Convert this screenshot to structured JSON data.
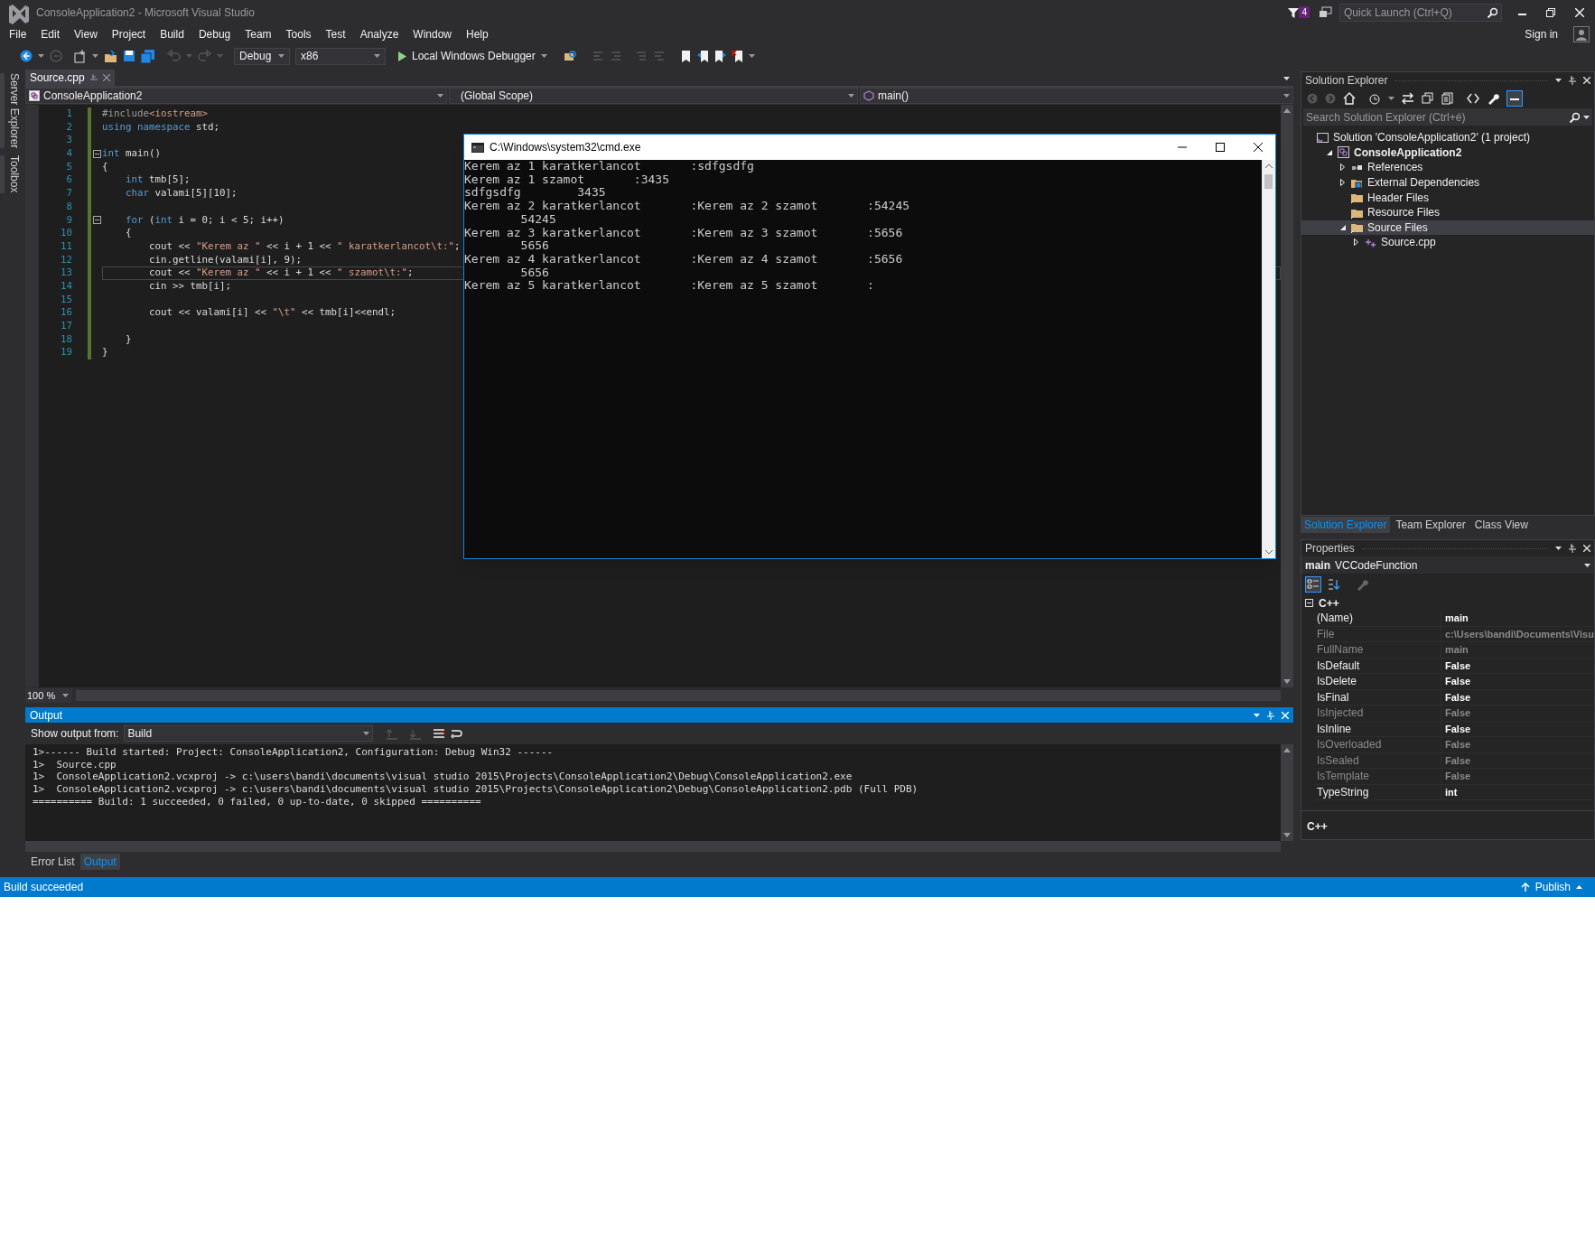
{
  "window": {
    "title": "ConsoleApplication2 - Microsoft Visual Studio"
  },
  "title_bar": {
    "notification_count": "4",
    "quick_launch": {
      "placeholder": "Quick Launch (Ctrl+Q)"
    },
    "sign_in": "Sign in"
  },
  "menu": [
    "File",
    "Edit",
    "View",
    "Project",
    "Build",
    "Debug",
    "Team",
    "Tools",
    "Test",
    "Analyze",
    "Window",
    "Help"
  ],
  "toolbar": {
    "configuration": "Debug",
    "platform": "x86",
    "start": "Local Windows Debugger"
  },
  "side_tabs": [
    "Server Explorer",
    "Toolbox"
  ],
  "editor": {
    "tabs": [
      {
        "label": "Source.cpp",
        "selected": true
      }
    ],
    "nav": {
      "project": "ConsoleApplication2",
      "scope": "(Global Scope)",
      "member": "main()"
    },
    "lines": [
      {
        "number": "1",
        "fold": false,
        "current": false,
        "tokens": [
          {
            "kind": "preprocessor",
            "text": "#include"
          },
          {
            "kind": "string",
            "text": "<iostream>"
          }
        ]
      },
      {
        "number": "2",
        "fold": false,
        "current": false,
        "tokens": [
          {
            "kind": "keyword",
            "text": "using namespace"
          },
          {
            "kind": "plain",
            "text": " std;"
          }
        ]
      },
      {
        "number": "3",
        "fold": false,
        "current": false
      },
      {
        "number": "4",
        "fold": true,
        "current": false,
        "tokens": [
          {
            "kind": "keyword",
            "text": "int"
          },
          {
            "kind": "plain",
            "text": " main()"
          }
        ]
      },
      {
        "number": "5",
        "fold": false,
        "current": false,
        "tokens": [
          {
            "kind": "plain",
            "text": "{"
          }
        ]
      },
      {
        "number": "6",
        "fold": false,
        "current": false,
        "tokens": [
          {
            "kind": "keyword",
            "text": "    int"
          },
          {
            "kind": "plain",
            "text": " tmb[5];"
          }
        ]
      },
      {
        "number": "7",
        "fold": false,
        "current": false,
        "tokens": [
          {
            "kind": "keyword",
            "text": "    char"
          },
          {
            "kind": "plain",
            "text": " valami[5][10];"
          }
        ]
      },
      {
        "number": "8",
        "fold": false,
        "current": false
      },
      {
        "number": "9",
        "fold": true,
        "current": false,
        "tokens": [
          {
            "kind": "keyword",
            "text": "    for"
          },
          {
            "kind": "plain",
            "text": " ("
          },
          {
            "kind": "keyword",
            "text": "int"
          },
          {
            "kind": "plain",
            "text": " i = 0; i < 5; i++)"
          }
        ]
      },
      {
        "number": "10",
        "fold": false,
        "current": false,
        "tokens": [
          {
            "kind": "plain",
            "text": "    {"
          }
        ]
      },
      {
        "number": "11",
        "fold": false,
        "current": false,
        "tokens": [
          {
            "kind": "plain",
            "text": "        cout << "
          },
          {
            "kind": "string",
            "text": "\"Kerem az \""
          },
          {
            "kind": "plain",
            "text": " << i + 1 << "
          },
          {
            "kind": "string",
            "text": "\" karatkerlancot\\t:\""
          },
          {
            "kind": "plain",
            "text": ";"
          }
        ]
      },
      {
        "number": "12",
        "fold": false,
        "current": false,
        "tokens": [
          {
            "kind": "plain",
            "text": "        cin.getline(valami[i], 9);"
          }
        ]
      },
      {
        "number": "13",
        "fold": false,
        "current": true,
        "tokens": [
          {
            "kind": "plain",
            "text": "        cout << "
          },
          {
            "kind": "string",
            "text": "\"Kerem az \""
          },
          {
            "kind": "plain",
            "text": " << i + 1 << "
          },
          {
            "kind": "string",
            "text": "\" szamot\\t:\""
          },
          {
            "kind": "plain",
            "text": ";"
          }
        ]
      },
      {
        "number": "14",
        "fold": false,
        "current": false,
        "tokens": [
          {
            "kind": "plain",
            "text": "        cin >> tmb[i];"
          }
        ]
      },
      {
        "number": "15",
        "fold": false,
        "current": false
      },
      {
        "number": "16",
        "fold": false,
        "current": false,
        "tokens": [
          {
            "kind": "plain",
            "text": "        cout << valami[i] << "
          },
          {
            "kind": "string",
            "text": "\"\\t\""
          },
          {
            "kind": "plain",
            "text": " << tmb[i]<<endl;"
          }
        ]
      },
      {
        "number": "17",
        "fold": false,
        "current": false
      },
      {
        "number": "18",
        "fold": false,
        "current": false,
        "tokens": [
          {
            "kind": "plain",
            "text": "    }"
          }
        ]
      },
      {
        "number": "19",
        "fold": false,
        "current": false,
        "tokens": [
          {
            "kind": "plain",
            "text": "}"
          }
        ]
      }
    ],
    "zoom": "100 %"
  },
  "console": {
    "title": "C:\\Windows\\system32\\cmd.exe",
    "lines": [
      "Kerem az 1 karatkerlancot       :sdfgsdfg",
      "Kerem az 1 szamot       :3435",
      "sdfgsdfg        3435",
      "Kerem az 2 karatkerlancot       :Kerem az 2 szamot       :54245",
      "        54245",
      "Kerem az 3 karatkerlancot       :Kerem az 3 szamot       :5656",
      "        5656",
      "Kerem az 4 karatkerlancot       :Kerem az 4 szamot       :5656",
      "        5656",
      "Kerem az 5 karatkerlancot       :Kerem az 5 szamot       :"
    ]
  },
  "solution_explorer": {
    "title": "Solution Explorer",
    "search": {
      "placeholder": "Search Solution Explorer (Ctrl+é)"
    },
    "tree": [
      {
        "label": "Solution 'ConsoleApplication2' (1 project)",
        "kind": "solution",
        "expandable": false,
        "startup": false,
        "selected": false,
        "children": [
          {
            "label": "ConsoleApplication2",
            "kind": "project",
            "expandable": true,
            "expanded": true,
            "startup": true,
            "selected": false,
            "children": [
              {
                "label": "References",
                "kind": "references",
                "expandable": true,
                "expanded": false,
                "startup": false,
                "selected": false
              },
              {
                "label": "External Dependencies",
                "kind": "external",
                "expandable": true,
                "expanded": false,
                "startup": false,
                "selected": false
              },
              {
                "label": "Header Files",
                "kind": "folder",
                "expandable": false,
                "startup": false,
                "selected": false
              },
              {
                "label": "Resource Files",
                "kind": "folder",
                "expandable": false,
                "startup": false,
                "selected": false
              },
              {
                "label": "Source Files",
                "kind": "folder",
                "expandable": true,
                "expanded": true,
                "startup": false,
                "selected": true,
                "children": [
                  {
                    "label": "Source.cpp",
                    "kind": "cpp",
                    "expandable": true,
                    "expanded": false,
                    "startup": false,
                    "selected": false
                  }
                ]
              }
            ]
          }
        ]
      }
    ]
  },
  "right_tabs": [
    {
      "label": "Solution Explorer",
      "selected": true
    },
    {
      "label": "Team Explorer",
      "selected": false
    },
    {
      "label": "Class View",
      "selected": false
    }
  ],
  "properties": {
    "title": "Properties",
    "object_name": "main",
    "object_type": "VCCodeFunction",
    "category": "C++",
    "rows": [
      {
        "name": "(Name)",
        "value": "main",
        "disabled": false
      },
      {
        "name": "File",
        "value": "c:\\Users\\bandi\\Documents\\Visu",
        "disabled": true
      },
      {
        "name": "FullName",
        "value": "main",
        "disabled": true
      },
      {
        "name": "IsDefault",
        "value": "False",
        "disabled": false
      },
      {
        "name": "IsDelete",
        "value": "False",
        "disabled": false
      },
      {
        "name": "IsFinal",
        "value": "False",
        "disabled": false
      },
      {
        "name": "IsInjected",
        "value": "False",
        "disabled": true
      },
      {
        "name": "IsInline",
        "value": "False",
        "disabled": false
      },
      {
        "name": "IsOverloaded",
        "value": "False",
        "disabled": true
      },
      {
        "name": "IsSealed",
        "value": "False",
        "disabled": true
      },
      {
        "name": "IsTemplate",
        "value": "False",
        "disabled": true
      },
      {
        "name": "TypeString",
        "value": "int",
        "disabled": false
      }
    ],
    "description": "C++"
  },
  "output": {
    "title": "Output",
    "source_label": "Show output from:",
    "source": "Build",
    "lines": [
      "1>------ Build started: Project: ConsoleApplication2, Configuration: Debug Win32 ------",
      "1>  Source.cpp",
      "1>  ConsoleApplication2.vcxproj -> c:\\users\\bandi\\documents\\visual studio 2015\\Projects\\ConsoleApplication2\\Debug\\ConsoleApplication2.exe",
      "1>  ConsoleApplication2.vcxproj -> c:\\users\\bandi\\documents\\visual studio 2015\\Projects\\ConsoleApplication2\\Debug\\ConsoleApplication2.pdb (Full PDB)",
      "========== Build: 1 succeeded, 0 failed, 0 up-to-date, 0 skipped =========="
    ]
  },
  "bottom_tabs": [
    {
      "label": "Error List",
      "selected": false
    },
    {
      "label": "Output",
      "selected": true
    }
  ],
  "status_bar": {
    "message": "Build succeeded",
    "publish": "Publish"
  }
}
